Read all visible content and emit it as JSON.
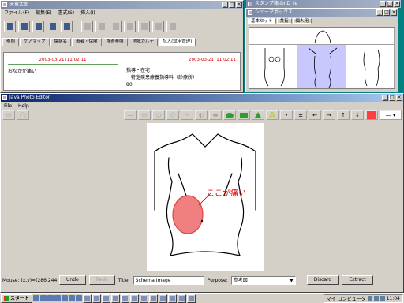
{
  "karte": {
    "title": "天童太郎",
    "menu": [
      "ファイル(F)",
      "編集(E)",
      "書式(S)",
      "挿入(I)"
    ],
    "tabs": [
      "参照",
      "ケアマップ",
      "傷病名",
      "患者・保険",
      "検査参照",
      "地域カルテ",
      "記入(試用管理)"
    ],
    "left_date": "2003-03-21T11:02:11",
    "left_text": "おなかが痛い",
    "right_date": "2003-03-21T11:02:11",
    "right_lines": [
      "指導・在宅",
      "・特定疾患療養指導料（診療所）",
      "80."
    ]
  },
  "stamp": {
    "title": "スタンプ箱-DnD_te"
  },
  "schema": {
    "title": "シェーマボックス",
    "tabs": [
      "基本セット",
      "共有",
      "個人用"
    ]
  },
  "editor": {
    "title": "Java Photo Editor",
    "menu": [
      "File",
      "Help"
    ],
    "annotation": "ここが痛い",
    "status": {
      "mouse": "Mouse: (x,y)=(286,244)",
      "undo": "Undo",
      "redo": "Redo",
      "title_label": "Title:",
      "title_value": "Schema Image",
      "purpose_label": "Purpose:",
      "purpose_value": "参考図",
      "discard": "Discard",
      "extract": "Extract"
    },
    "colors": {
      "fill": "#ff4040",
      "marker": "#ff4040"
    }
  },
  "taskbar": {
    "start": "スタート",
    "tray_label": "マイ コンピュータ",
    "clock": "11:04"
  }
}
